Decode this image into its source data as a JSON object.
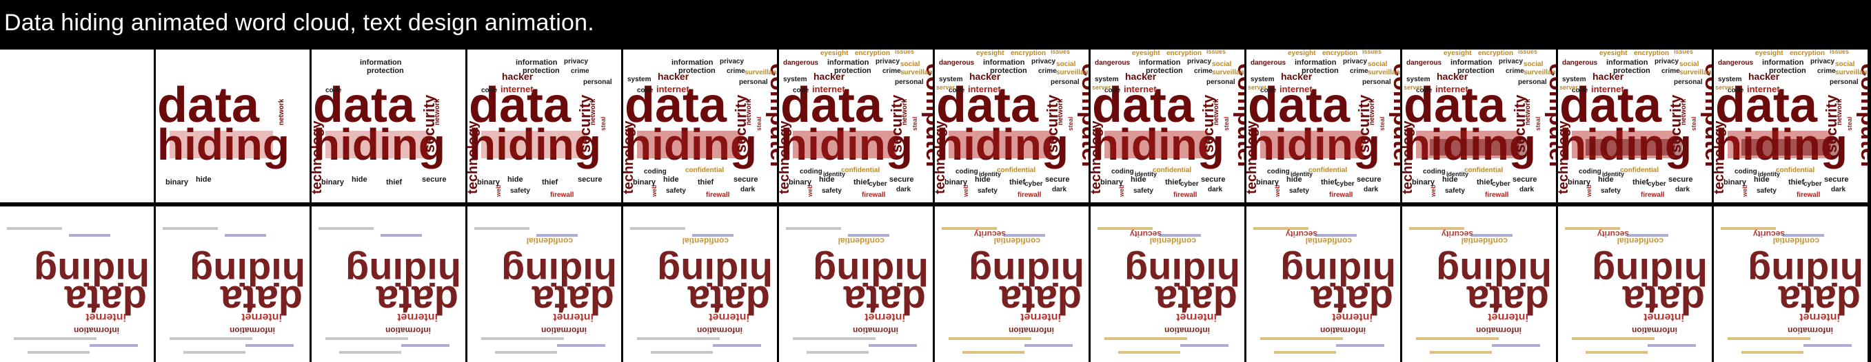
{
  "title": "Data hiding animated word cloud, text design animation.",
  "colors": {
    "dark_red": "#6b0a0a",
    "red": "#b0201a",
    "gold": "#c08a1a",
    "black": "#1a1a1a",
    "background": "#ffffff"
  },
  "row1_frames": [
    {
      "id": 1,
      "stage": 0
    },
    {
      "id": 2,
      "stage": 1
    },
    {
      "id": 3,
      "stage": 2
    },
    {
      "id": 4,
      "stage": 3
    },
    {
      "id": 5,
      "stage": 4
    },
    {
      "id": 6,
      "stage": 5
    },
    {
      "id": 7,
      "stage": 6
    },
    {
      "id": 8,
      "stage": 6
    },
    {
      "id": 9,
      "stage": 6
    },
    {
      "id": 10,
      "stage": 7
    },
    {
      "id": 11,
      "stage": 7
    },
    {
      "id": 12,
      "stage": 7
    }
  ],
  "row2_frames": [
    {
      "id": 13,
      "variant": 1
    },
    {
      "id": 14,
      "variant": 1
    },
    {
      "id": 15,
      "variant": 1
    },
    {
      "id": 16,
      "variant": 2
    },
    {
      "id": 17,
      "variant": 2
    },
    {
      "id": 18,
      "variant": 2
    },
    {
      "id": 19,
      "variant": 3
    },
    {
      "id": 20,
      "variant": 3
    },
    {
      "id": 21,
      "variant": 3
    },
    {
      "id": 22,
      "variant": 4
    },
    {
      "id": 23,
      "variant": 4
    },
    {
      "id": 24,
      "variant": 4
    }
  ],
  "words": {
    "main1": "data",
    "main2": "hiding",
    "technology": "technology",
    "computer": "computer",
    "security": "security",
    "network": "network",
    "internet": "internet",
    "hacker": "hacker",
    "information": "information",
    "privacy": "privacy",
    "protection": "protection",
    "crime": "crime",
    "personal": "personal",
    "code": "code",
    "binary": "binary",
    "hide": "hide",
    "thief": "thief",
    "secure": "secure",
    "system": "system",
    "surveillance": "surveillance",
    "safety": "safety",
    "firewall": "firewall",
    "coding": "coding",
    "web": "web",
    "dark": "dark",
    "cyber": "cyber",
    "confidential": "confidential",
    "identity": "identity",
    "eyesight": "eyesight",
    "encryption": "encryption",
    "issues": "issues",
    "dangerous": "dangerous",
    "social": "social",
    "server": "server",
    "steal": "steal",
    "spy": "spy"
  }
}
